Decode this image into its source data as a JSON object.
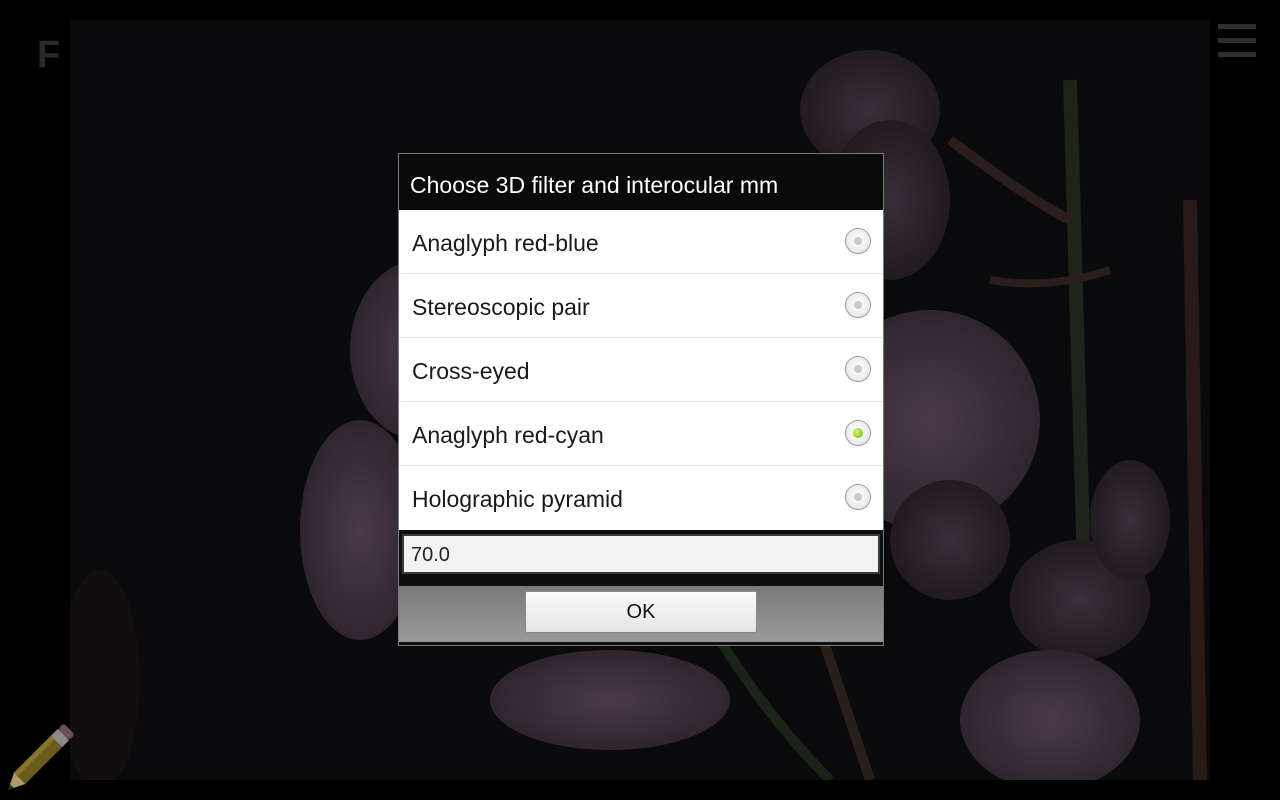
{
  "app": {
    "letter": "F"
  },
  "dialog": {
    "title": "Choose 3D filter and interocular mm",
    "options": [
      {
        "label": "Anaglyph red-blue",
        "checked": false
      },
      {
        "label": "Stereoscopic pair",
        "checked": false
      },
      {
        "label": "Cross-eyed",
        "checked": false
      },
      {
        "label": "Anaglyph red-cyan",
        "checked": true
      },
      {
        "label": "Holographic pyramid",
        "checked": false
      }
    ],
    "interocular_value": "70.0",
    "ok_label": "OK"
  },
  "icons": {
    "menu": "menu-icon",
    "pencil": "pencil-icon"
  },
  "colors": {
    "radio_checked": "#8fd11c",
    "dialog_title_bg": "#0a0a0a",
    "button_bar": "#8a8a8a"
  }
}
